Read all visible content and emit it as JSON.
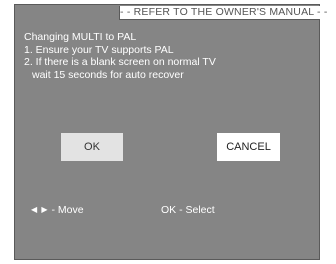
{
  "title": "- - REFER TO THE OWNER'S MANUAL - -",
  "message": {
    "line1": "Changing MULTI to PAL",
    "line2": "1. Ensure your TV supports PAL",
    "line3": "2. If there is a blank screen on normal TV",
    "line4": "wait 15 seconds for auto recover"
  },
  "buttons": {
    "ok_label": "OK",
    "cancel_label": "CANCEL"
  },
  "footer": {
    "move_arrows": "◀ ▶",
    "move_label": "- Move",
    "select_label": "OK - Select"
  },
  "colors": {
    "dialog_background": "#858585",
    "ok_button_background": "#e3e3e3",
    "cancel_button_background": "#ffffff",
    "text": "#ffffff"
  }
}
